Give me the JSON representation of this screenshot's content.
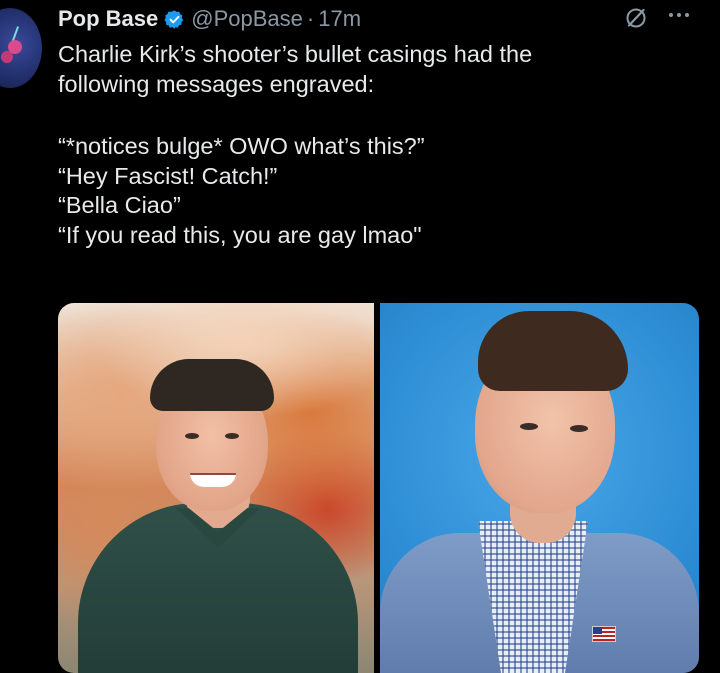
{
  "post": {
    "author_name": "Pop Base",
    "author_handle": "@PopBase",
    "separator": "·",
    "timestamp": "17m",
    "verified": true,
    "accent_color": "#1d9bf0",
    "text_lines": [
      "Charlie Kirk’s shooter’s bullet casings had the",
      "following messages engraved:",
      "",
      "“*notices bulge* OWO what’s this?”",
      "“Hey Fascist! Catch!”",
      "“Bella Ciao”",
      "“If you read this, you are gay lmao\""
    ],
    "icons": {
      "verified": "verified-badge-icon",
      "grok": "grok-icon",
      "more": "more-options-icon"
    },
    "media": [
      {
        "label": "photo-left"
      },
      {
        "label": "photo-right"
      }
    ]
  }
}
